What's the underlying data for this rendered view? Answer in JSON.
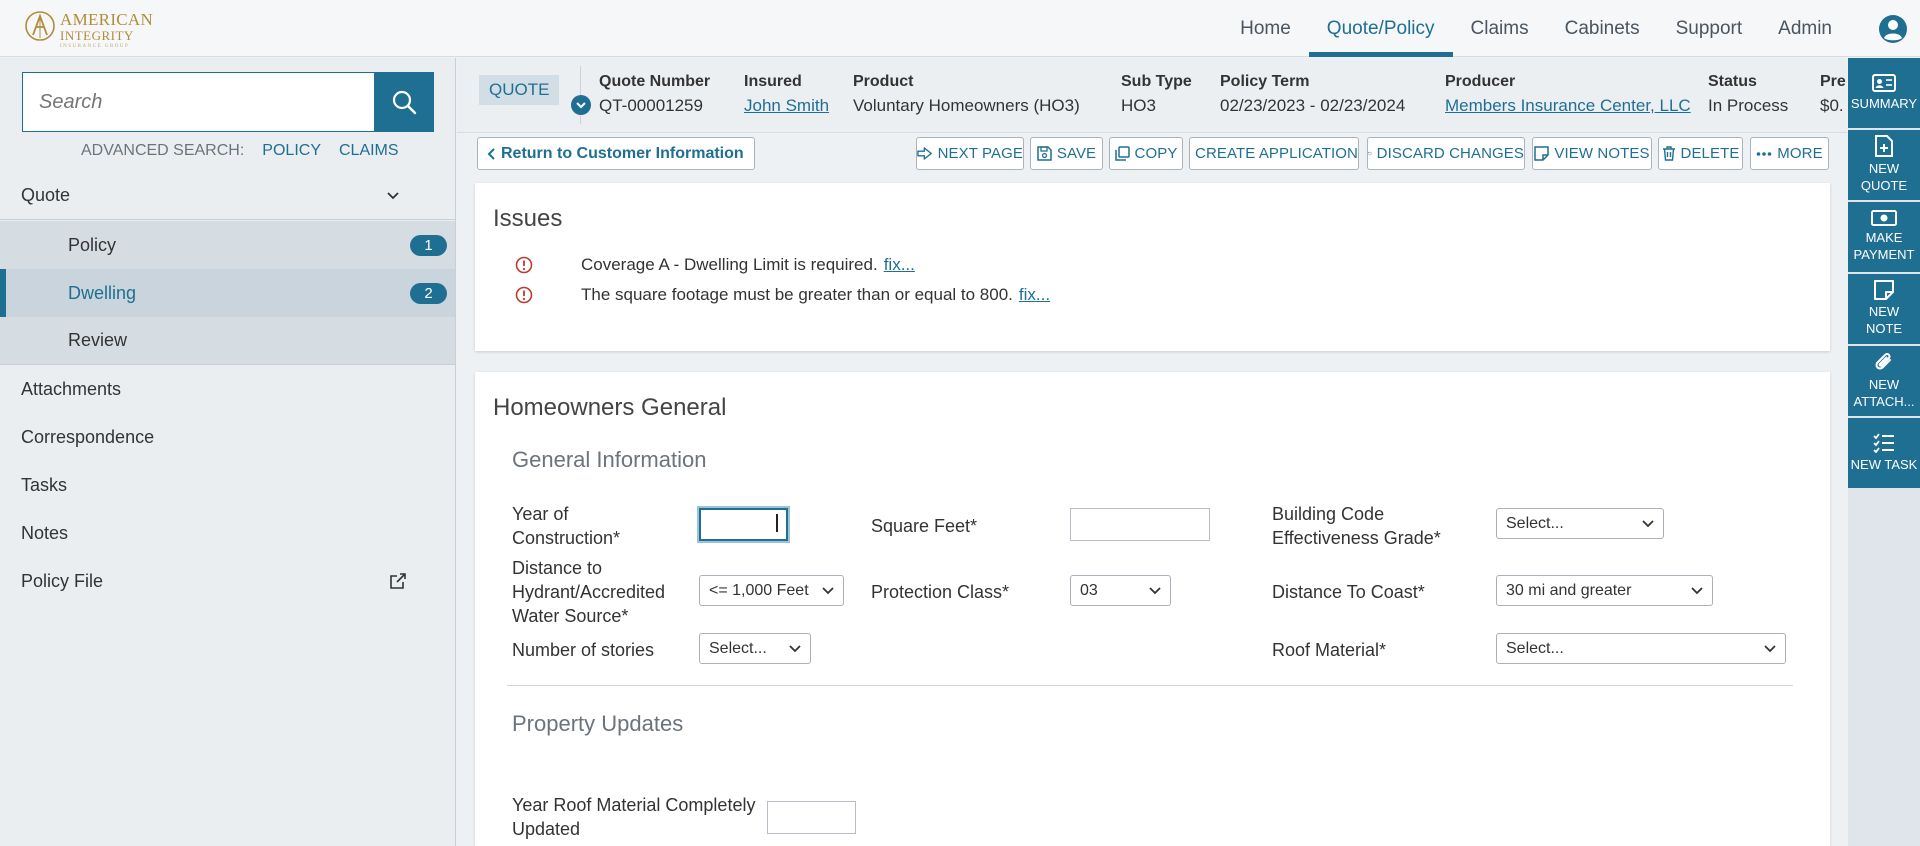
{
  "brand": {
    "line1": "AMERICAN",
    "line2": "INTEGRITY",
    "line3": "INSURANCE GROUP"
  },
  "nav": {
    "items": [
      "Home",
      "Quote/Policy",
      "Claims",
      "Cabinets",
      "Support",
      "Admin"
    ],
    "active": "Quote/Policy"
  },
  "sidebar": {
    "search_placeholder": "Search",
    "advanced_label": "ADVANCED SEARCH:",
    "advanced_policy": "POLICY",
    "advanced_claims": "CLAIMS",
    "quote_label": "Quote",
    "sub_items": [
      {
        "label": "Policy",
        "badge": "1"
      },
      {
        "label": "Dwelling",
        "badge": "2"
      },
      {
        "label": "Review",
        "badge": ""
      }
    ],
    "items": [
      "Attachments",
      "Correspondence",
      "Tasks",
      "Notes",
      "Policy File"
    ]
  },
  "header": {
    "tag": "QUOTE",
    "fields": [
      {
        "key": "Quote Number",
        "value": "QT-00001259"
      },
      {
        "key": "Insured",
        "value": "John Smith"
      },
      {
        "key": "Product",
        "value": "Voluntary Homeowners (HO3)"
      },
      {
        "key": "Sub Type",
        "value": "HO3"
      },
      {
        "key": "Policy Term",
        "value": "02/23/2023 - 02/23/2024"
      },
      {
        "key": "Producer",
        "value": "Members Insurance Center, LLC"
      },
      {
        "key": "Status",
        "value": "In Process"
      },
      {
        "key": "Pre",
        "value": "$0."
      }
    ]
  },
  "toolbar": {
    "return_label": "Return to Customer Information",
    "next_page": "NEXT PAGE",
    "save": "SAVE",
    "copy": "COPY",
    "create_application": "CREATE APPLICATION",
    "discard_changes": "DISCARD CHANGES",
    "view_notes": "VIEW NOTES",
    "delete": "DELETE",
    "more": "MORE"
  },
  "rail": [
    {
      "label": "SUMMARY"
    },
    {
      "label": "NEW QUOTE"
    },
    {
      "label": "MAKE PAYMENT"
    },
    {
      "label": "NEW NOTE"
    },
    {
      "label": "NEW ATTACH..."
    },
    {
      "label": "NEW TASK"
    }
  ],
  "issues": {
    "title": "Issues",
    "fix_label": "fix...",
    "list": [
      "Coverage A - Dwelling Limit is required.",
      "The square footage must be greater than or equal to 800."
    ]
  },
  "form": {
    "title": "Homeowners General",
    "general_info": "General Information",
    "year_of_construction": {
      "label_line1": "Year of",
      "label_line2": "Construction*",
      "value": ""
    },
    "square_feet": {
      "label": "Square Feet*",
      "value": ""
    },
    "building_code": {
      "label_line1": "Building Code",
      "label_line2": "Effectiveness Grade*",
      "value": "Select..."
    },
    "hydrant": {
      "label_line1": "Distance to",
      "label_line2": "Hydrant/Accredited",
      "label_line3": "Water Source*",
      "value": "<= 1,000 Feet"
    },
    "protection_class": {
      "label": "Protection Class*",
      "value": "03"
    },
    "distance_coast": {
      "label": "Distance To Coast*",
      "value": "30 mi and greater"
    },
    "stories": {
      "label": "Number of stories",
      "value": "Select..."
    },
    "roof_material": {
      "label": "Roof Material*",
      "value": "Select..."
    },
    "property_updates": "Property Updates",
    "roof_year": {
      "label_line1": "Year Roof Material Completely",
      "label_line2": "Updated",
      "value": ""
    }
  },
  "colors": {
    "primary": "#1f6f93",
    "brand_gold": "#b08d3c",
    "error": "#c0392b"
  }
}
